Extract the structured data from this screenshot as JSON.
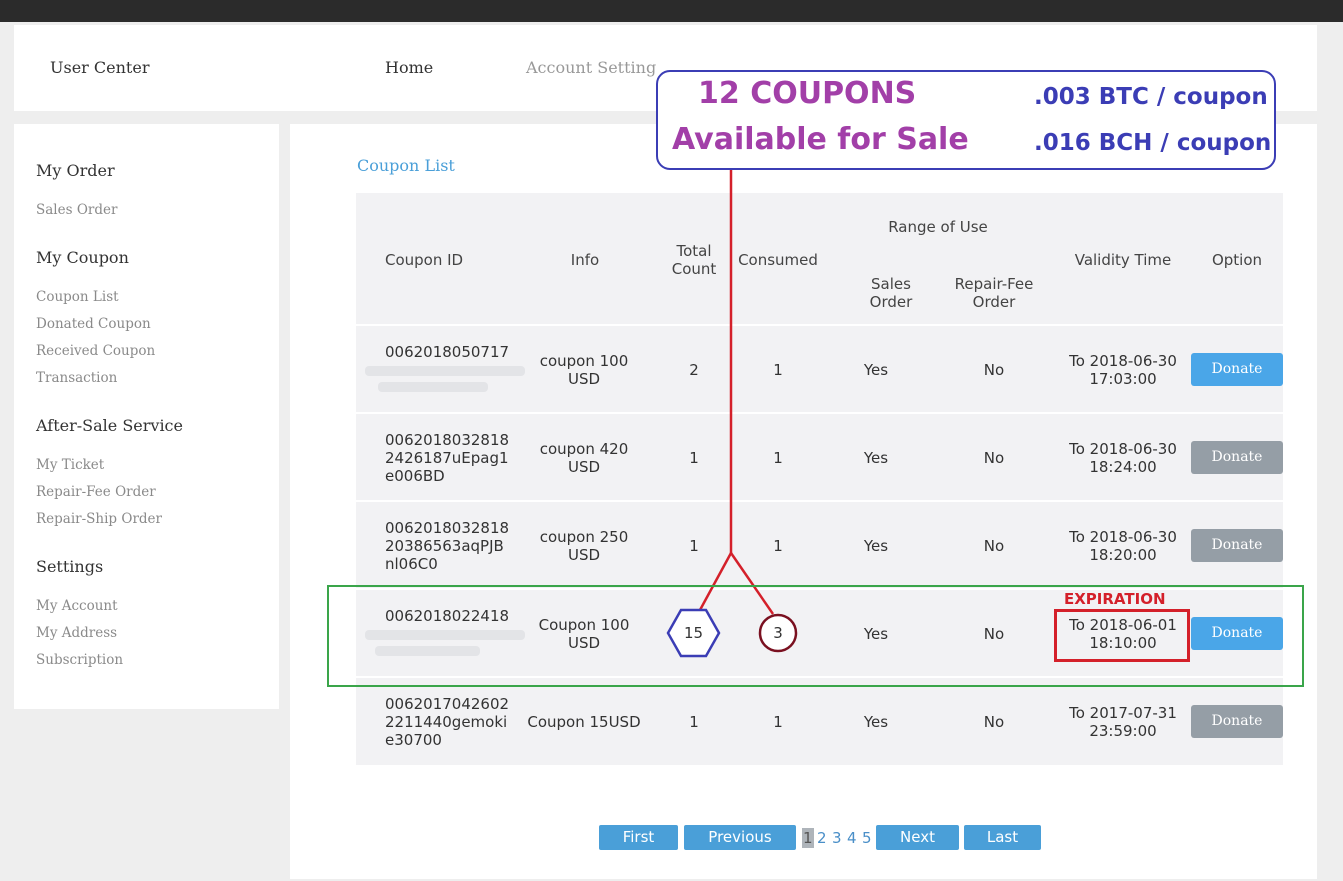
{
  "header": {
    "title": "User Center",
    "nav": {
      "home": "Home",
      "account_setting": "Account Setting"
    }
  },
  "sidebar": {
    "sections": [
      {
        "title": "My Order",
        "items": [
          "Sales Order"
        ]
      },
      {
        "title": "My Coupon",
        "items": [
          "Coupon List",
          "Donated Coupon",
          "Received Coupon",
          "Transaction"
        ]
      },
      {
        "title": "After-Sale Service",
        "items": [
          "My Ticket",
          "Repair-Fee Order",
          "Repair-Ship Order"
        ]
      },
      {
        "title": "Settings",
        "items": [
          "My Account",
          "My Address",
          "Subscription"
        ]
      }
    ]
  },
  "main": {
    "title": "Coupon List",
    "table": {
      "headers": {
        "coupon_id": "Coupon ID",
        "info": "Info",
        "total_count_1": "Total",
        "total_count_2": "Count",
        "consumed": "Consumed",
        "range_of_use": "Range of Use",
        "sales_order_1": "Sales",
        "sales_order_2": "Order",
        "repair_fee_1": "Repair-Fee",
        "repair_fee_2": "Order",
        "validity_time": "Validity Time",
        "option": "Option"
      },
      "rows": [
        {
          "id1": "0062018050717",
          "id2": "",
          "id3": "",
          "info1": "coupon 100",
          "info2": "USD",
          "total": "2",
          "consumed": "1",
          "sales": "Yes",
          "repair": "No",
          "valid1": "To 2018-06-30",
          "valid2": "17:03:00",
          "option": "Donate",
          "btn_state": "active"
        },
        {
          "id1": "0062018032818",
          "id2": "2426187uEpag1",
          "id3": "e006BD",
          "info1": "coupon 420",
          "info2": "USD",
          "total": "1",
          "consumed": "1",
          "sales": "Yes",
          "repair": "No",
          "valid1": "To 2018-06-30",
          "valid2": "18:24:00",
          "option": "Donate",
          "btn_state": "disabled"
        },
        {
          "id1": "0062018032818",
          "id2": "20386563aqPJB",
          "id3": "nl06C0",
          "info1": "coupon 250",
          "info2": "USD",
          "total": "1",
          "consumed": "1",
          "sales": "Yes",
          "repair": "No",
          "valid1": "To 2018-06-30",
          "valid2": "18:20:00",
          "option": "Donate",
          "btn_state": "disabled"
        },
        {
          "id1": "0062018022418",
          "id2": "",
          "id3": "",
          "info1": "Coupon 100",
          "info2": "USD",
          "total": "15",
          "consumed": "3",
          "sales": "Yes",
          "repair": "No",
          "valid1": "To 2018-06-01",
          "valid2": "18:10:00",
          "option": "Donate",
          "btn_state": "active"
        },
        {
          "id1": "0062017042602",
          "id2": "2211440gemoki",
          "id3": "e30700",
          "info1": "Coupon 15USD",
          "info2": "",
          "total": "1",
          "consumed": "1",
          "sales": "Yes",
          "repair": "No",
          "valid1": "To 2017-07-31",
          "valid2": "23:59:00",
          "option": "Donate",
          "btn_state": "disabled"
        }
      ]
    }
  },
  "pagination": {
    "first": "First",
    "previous": "Previous",
    "pages": [
      "1",
      "2",
      "3",
      "4",
      "5"
    ],
    "current": "1",
    "next": "Next",
    "last": "Last"
  },
  "annotation": {
    "count": "12  COUPONS",
    "availability": "Available for Sale",
    "btc_price": ".003 BTC / coupon",
    "bch_price": ".016 BCH / coupon",
    "expiration": "EXPIRATION",
    "colors": {
      "purple": "#a23fa8",
      "blue": "#3b3db5",
      "red": "#d4202a",
      "green": "#3aa54a",
      "dark_red": "#7a1020"
    }
  }
}
